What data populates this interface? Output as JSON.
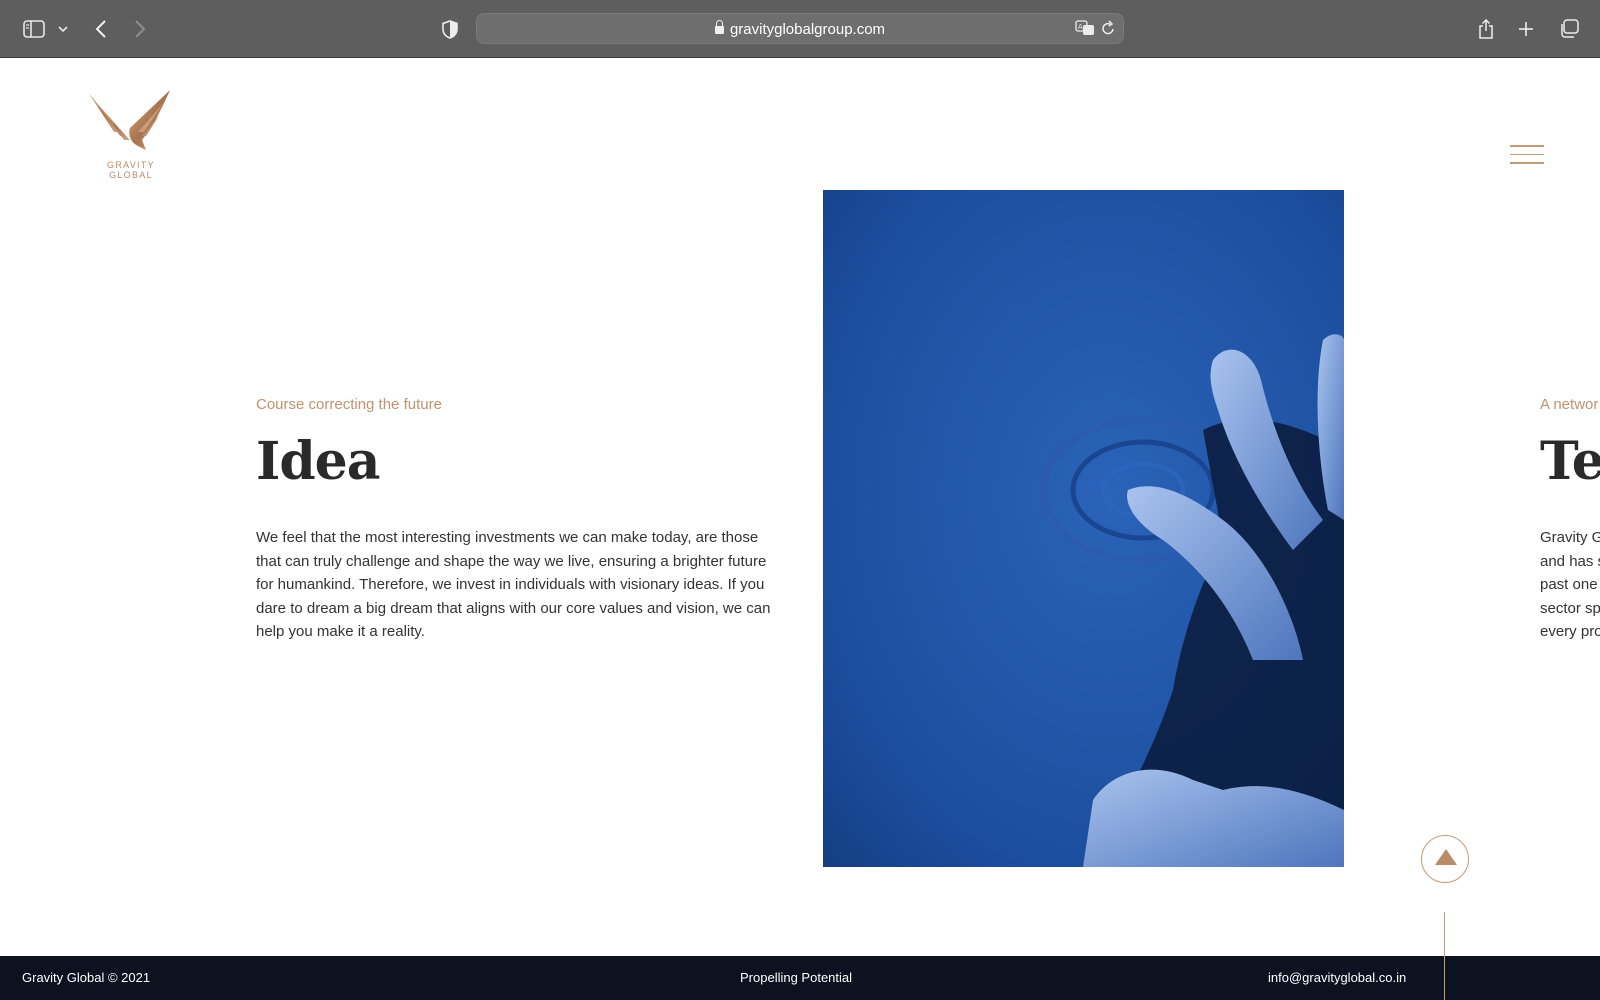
{
  "browser": {
    "url": "gravityglobalgroup.com",
    "icons": [
      "sidebar-icon",
      "chevron-down-icon",
      "back-icon",
      "forward-icon",
      "shield-icon",
      "lock-icon",
      "translate-icon",
      "reload-icon",
      "share-icon",
      "plus-icon",
      "tabs-icon"
    ]
  },
  "brand": {
    "name": "GRAVITY GLOBAL",
    "accent": "#c49a78"
  },
  "sections": [
    {
      "eyebrow": "Course correcting the future",
      "heading": "Idea",
      "body": "We feel that the most interesting investments we can make today, are those that can truly challenge and shape the way we live, ensuring a brighter future for humankind. Therefore, we invest in individuals with visionary ideas. If you dare to dream a big dream that aligns with our core values and vision, we can help you make it a reality."
    },
    {
      "eyebrow": "A networ",
      "heading": "Te",
      "body_lines": [
        "Gravity G",
        "and has s",
        "past one",
        "sector sp",
        "every pro"
      ]
    }
  ],
  "footer": {
    "copyright": "Gravity Global © 2021",
    "tagline": "Propelling Potential",
    "email": "info@gravityglobal.co.in",
    "background": "#0d1220"
  }
}
